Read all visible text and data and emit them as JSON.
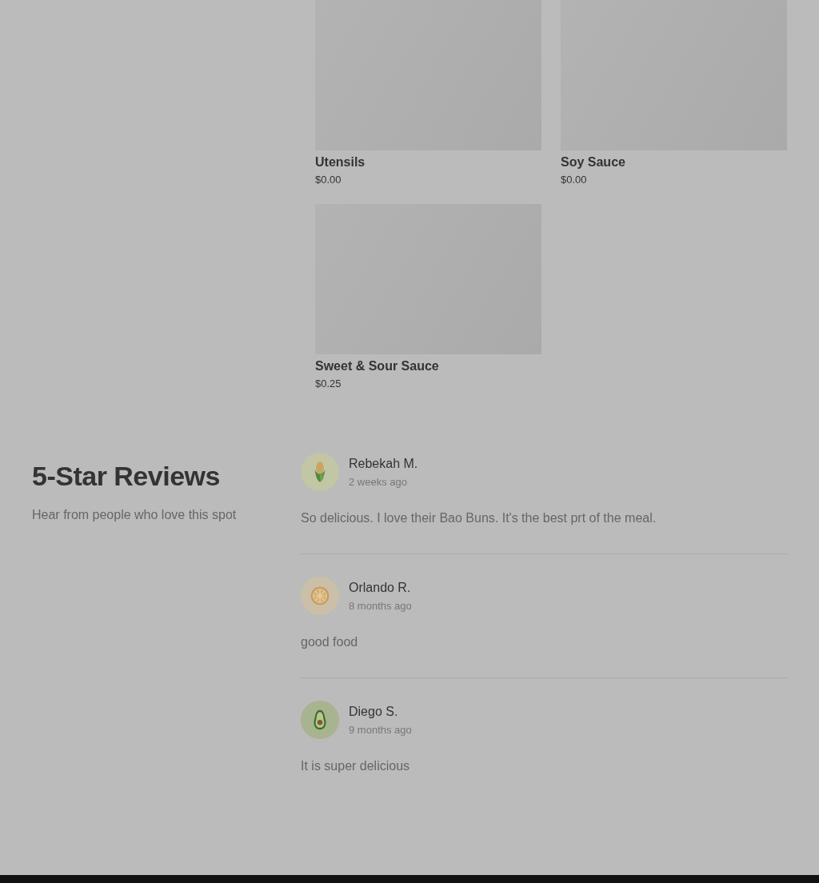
{
  "products": [
    {
      "name": "Utensils",
      "price": "$0.00"
    },
    {
      "name": "Soy Sauce",
      "price": "$0.00"
    },
    {
      "name": "Sweet & Sour Sauce",
      "price": "$0.25"
    }
  ],
  "reviews_section": {
    "title": "5-Star Reviews",
    "subtitle": "Hear from people who love this spot"
  },
  "reviews": [
    {
      "avatar": {
        "kind": "corn"
      },
      "author": "Rebekah M.",
      "time": "2 weeks ago",
      "text": "So delicious. I love their Bao Buns. It's the best prt of the meal."
    },
    {
      "avatar": {
        "kind": "orange"
      },
      "author": "Orlando R.",
      "time": "8 months ago",
      "text": "good food"
    },
    {
      "avatar": {
        "kind": "avocado"
      },
      "author": "Diego S.",
      "time": "9 months ago",
      "text": "It is super delicious"
    }
  ]
}
